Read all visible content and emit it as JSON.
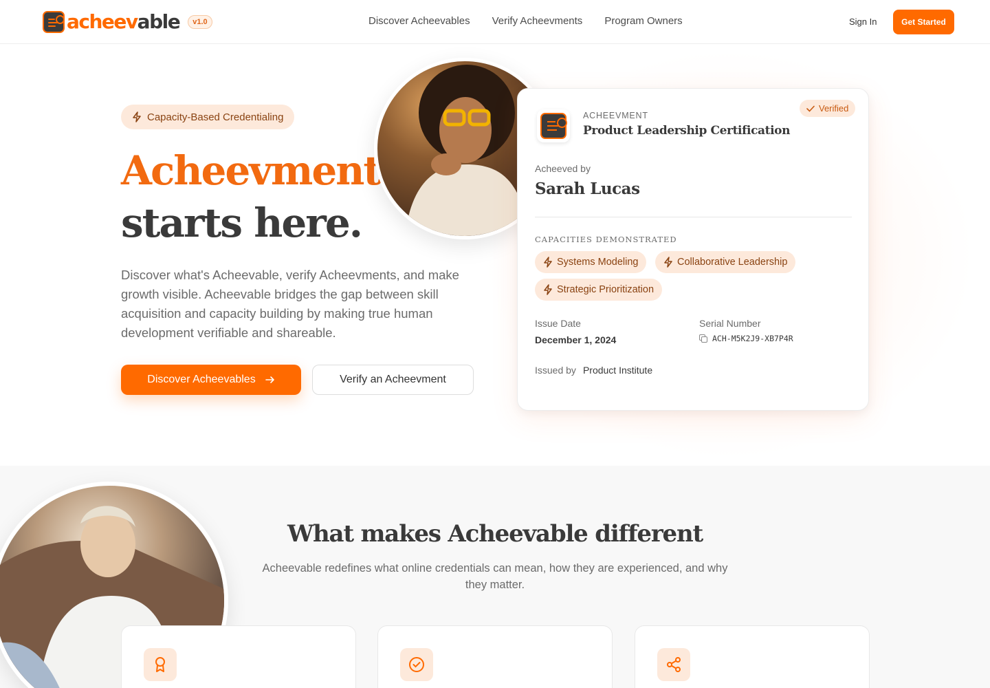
{
  "brand": {
    "name_part1": "achee",
    "name_part2": "v",
    "name_part3": "able",
    "version": "v1.0",
    "accent": "#ff6a00"
  },
  "nav": {
    "items": [
      "Discover Acheevables",
      "Verify Acheevments",
      "Program Owners"
    ],
    "signin": "Sign In",
    "cta": "Get Started"
  },
  "hero": {
    "pill": "Capacity-Based Credentialing",
    "title_line1": "Acheevment",
    "title_line2": "starts here.",
    "description": "Discover what's Acheevable, verify Acheevments, and make growth visible. Acheevable bridges the gap between skill acquisition and capacity building by making true human development verifiable and shareable.",
    "primary_button": "Discover Acheevables",
    "secondary_button": "Verify an Acheevment"
  },
  "card": {
    "kicker": "ACHEEVMENT",
    "title": "Product Leadership Certification",
    "status": "Verified",
    "achieved_by_label": "Acheeved by",
    "achieved_by_name": "Sarah Lucas",
    "capacities_heading": "CAPACITIES DEMONSTRATED",
    "capacities": [
      "Systems Modeling",
      "Collaborative Leadership",
      "Strategic Prioritization"
    ],
    "issue_date_label": "Issue Date",
    "issue_date": "December 1, 2024",
    "serial_label": "Serial Number",
    "serial": "ACH-M5K2J9-XB7P4R",
    "issued_by_label": "Issued by",
    "issued_by": "Product Institute"
  },
  "section2": {
    "title": "What makes Acheevable different",
    "subtitle": "Acheevable redefines what online credentials can mean, how they are experienced, and why they matter.",
    "features": [
      {
        "icon": "award-icon"
      },
      {
        "icon": "check-circle-icon"
      },
      {
        "icon": "share-icon"
      }
    ]
  }
}
